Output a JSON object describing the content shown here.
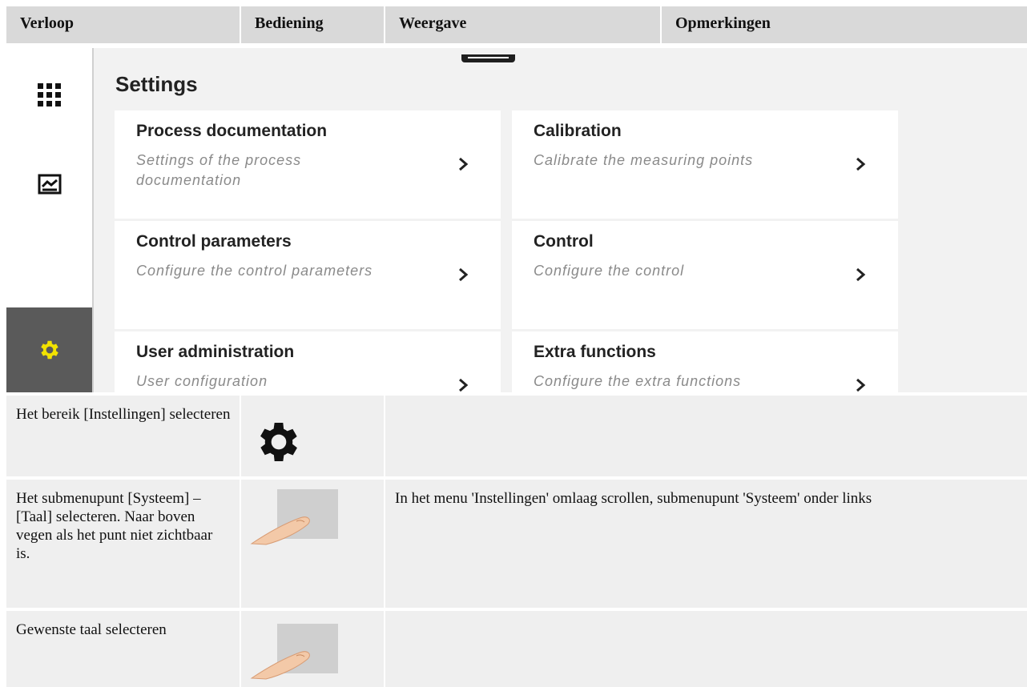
{
  "header": {
    "col1": "Verloop",
    "col2": "Bediening",
    "col3": "Weergave",
    "col4": "Opmerkingen"
  },
  "device": {
    "title": "Settings",
    "sidebar": [
      {
        "icon": "apps-grid-icon",
        "active": false
      },
      {
        "icon": "chart-icon",
        "active": false
      },
      {
        "icon": "gear-icon",
        "active": true
      }
    ],
    "active_color": "#f2e200",
    "cards": [
      {
        "title": "Process documentation",
        "desc": "Settings of the process documentation"
      },
      {
        "title": "Calibration",
        "desc": "Calibrate the measuring points"
      },
      {
        "title": "Control parameters",
        "desc": "Configure the control parameters"
      },
      {
        "title": "Control",
        "desc": "Configure the control"
      },
      {
        "title": "User administration",
        "desc": "User configuration"
      },
      {
        "title": "Extra functions",
        "desc": "Configure the extra functions"
      }
    ]
  },
  "rows": [
    {
      "step": "Het bereik [Instellingen] selecteren",
      "icon": "gear-icon",
      "remark": ""
    },
    {
      "step": "Het submenupunt [Systeem] – [Taal] selecteren. Naar boven vegen als het punt niet zichtbaar is.",
      "icon": "finger-tap-icon",
      "remark": "In het menu 'Instellingen' omlaag scrollen, submenupunt 'Systeem' onder links"
    },
    {
      "step": "Gewenste taal selecteren",
      "icon": "finger-tap-icon",
      "remark": ""
    }
  ]
}
